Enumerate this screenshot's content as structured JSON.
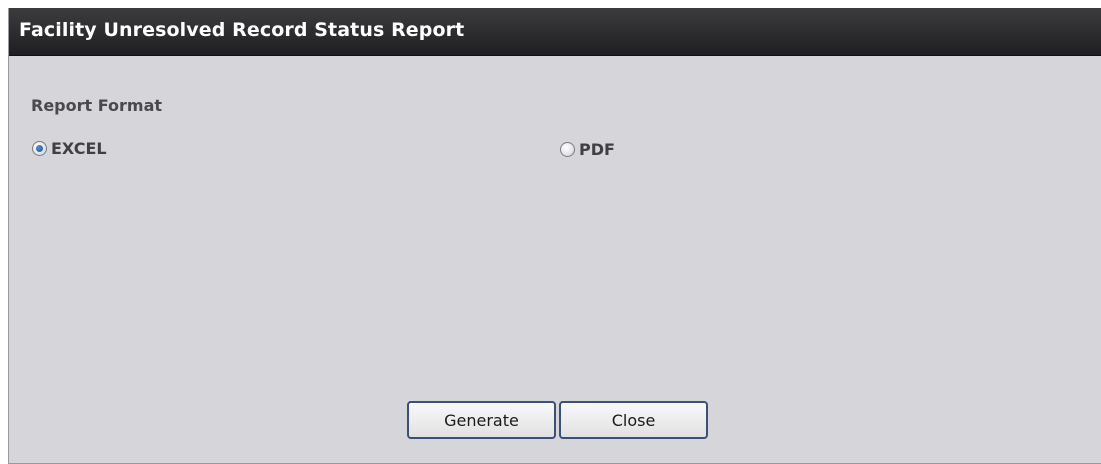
{
  "dialog": {
    "title": "Facility Unresolved Record Status Report"
  },
  "report_format": {
    "label": "Report Format",
    "options": [
      {
        "label": "EXCEL",
        "selected": true
      },
      {
        "label": "PDF",
        "selected": false
      }
    ]
  },
  "buttons": {
    "generate_label": "Generate",
    "close_label": "Close"
  }
}
